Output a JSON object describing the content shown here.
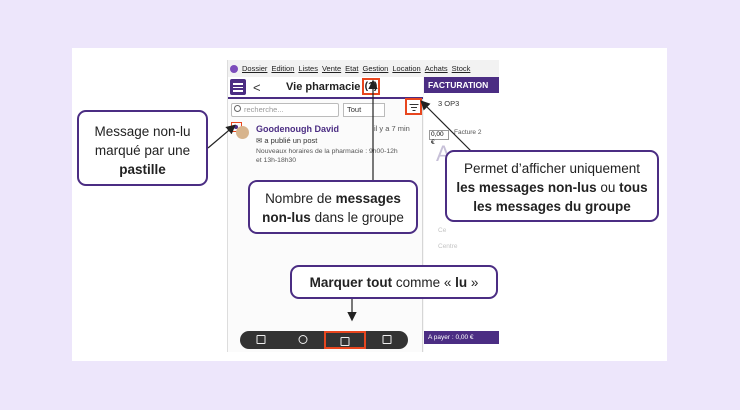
{
  "menu": [
    "Dossier",
    "Edition",
    "Listes",
    "Vente",
    "Etat",
    "Gestion",
    "Location",
    "Achats",
    "Stock"
  ],
  "panel": {
    "back": "<",
    "title": "Vie pharmacie",
    "unread_count": "(1)",
    "search_placeholder": "recherche...",
    "filter_value": "Tout"
  },
  "message": {
    "author": "Goodenough David",
    "time": "il y a 7 min",
    "action": "a publié un post",
    "body_line1": "Nouveaux horaires de la pharmacie : 9h00-12h",
    "body_line2": "et 13h-18h30"
  },
  "bottom_bar": {
    "icons": [
      "calendar-icon",
      "group-icon",
      "inbox-icon",
      "compose-icon"
    ]
  },
  "side": {
    "header": "FACTURATION",
    "op": "3 OP3",
    "amount_small": "0,00 €",
    "tab": "Facture 2",
    "ghost_labels": [
      "Ce",
      "Centre"
    ],
    "pay": "A payer :  0,00 €"
  },
  "callouts": {
    "pastille": {
      "l1": "Message non-lu",
      "l2": "marqué par une",
      "l3": "pastille"
    },
    "count": {
      "l1a": "Nombre de ",
      "l1b": "messages",
      "l2a": "non-lus",
      "l2b": " dans le groupe"
    },
    "filter": {
      "l1": "Permet d’afficher uniquement",
      "l2a": "les messages non-lus",
      "l2b": " ou ",
      "l2c": "tous",
      "l3": "les messages du groupe"
    },
    "mark": {
      "a": "Marquer tout",
      "b": " comme « ",
      "c": "lu",
      "d": " »"
    }
  },
  "colors": {
    "accent": "#4b2d83",
    "highlight": "#e8461e",
    "background": "#ede6fb"
  }
}
